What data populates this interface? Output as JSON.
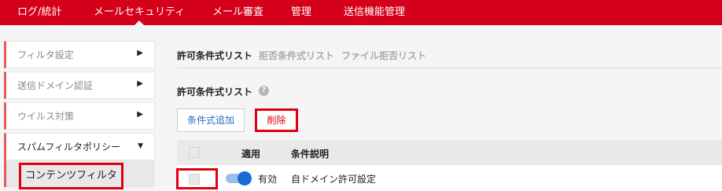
{
  "topnav": {
    "items": [
      "ログ/統計",
      "メールセキュリティ",
      "メール審査",
      "管理",
      "送信機能管理"
    ],
    "active_index": 1
  },
  "sidebar": {
    "items": [
      {
        "label": "フィルタ設定",
        "icon": "chevron-right-icon"
      },
      {
        "label": "送信ドメイン認証",
        "icon": "chevron-right-icon"
      },
      {
        "label": "ウイルス対策",
        "icon": "chevron-right-icon"
      },
      {
        "label": "スパムフィルタポリシー",
        "icon": "chevron-down-icon"
      }
    ],
    "sub_item": "コンテンツフィルタ"
  },
  "tabs": [
    "許可条件式リスト",
    "拒否条件式リスト",
    "ファイル拒否リスト"
  ],
  "active_tab": 0,
  "section": {
    "title": "許可条件式リスト",
    "help": "?"
  },
  "buttons": {
    "add": "条件式追加",
    "delete": "削除"
  },
  "table": {
    "columns": [
      "適用",
      "条件説明"
    ],
    "rows": [
      {
        "enabled": true,
        "enabled_label": "有効",
        "description": "自ドメイン許可設定"
      }
    ]
  },
  "colors": {
    "brand": "#d50019",
    "highlight": "#e00012",
    "link": "#2a6bc8",
    "toggle": "#1a6bd6"
  }
}
